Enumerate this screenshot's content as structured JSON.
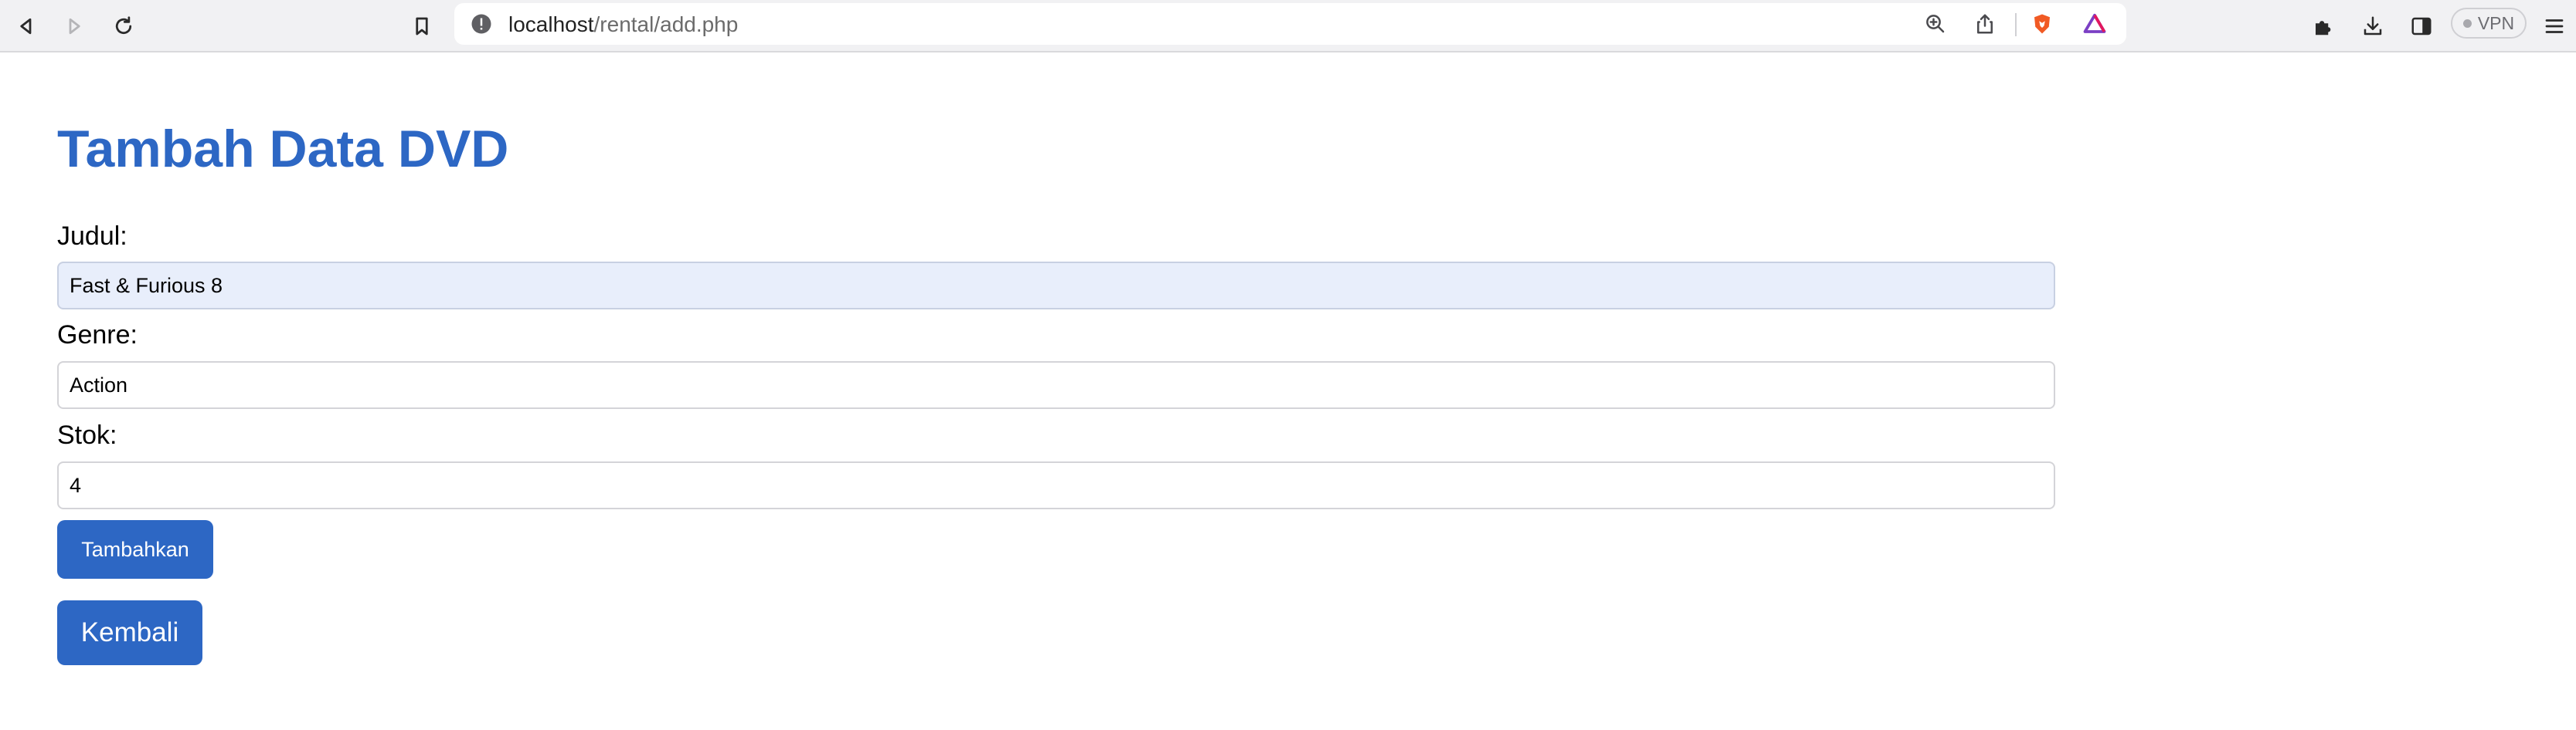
{
  "browser": {
    "url_host": "localhost",
    "url_path": "/rental/add.php",
    "vpn_label": "VPN"
  },
  "page": {
    "title": "Tambah Data DVD",
    "fields": [
      {
        "label": "Judul:",
        "value": "Fast & Furious 8"
      },
      {
        "label": "Genre:",
        "value": "Action"
      },
      {
        "label": "Stok:",
        "value": "4"
      }
    ],
    "submit_label": "Tambahkan",
    "back_label": "Kembali"
  },
  "colors": {
    "accent": "#2d67c4",
    "autofill_bg": "#e8eefb",
    "toolbar_bg": "#f1f1f3"
  }
}
